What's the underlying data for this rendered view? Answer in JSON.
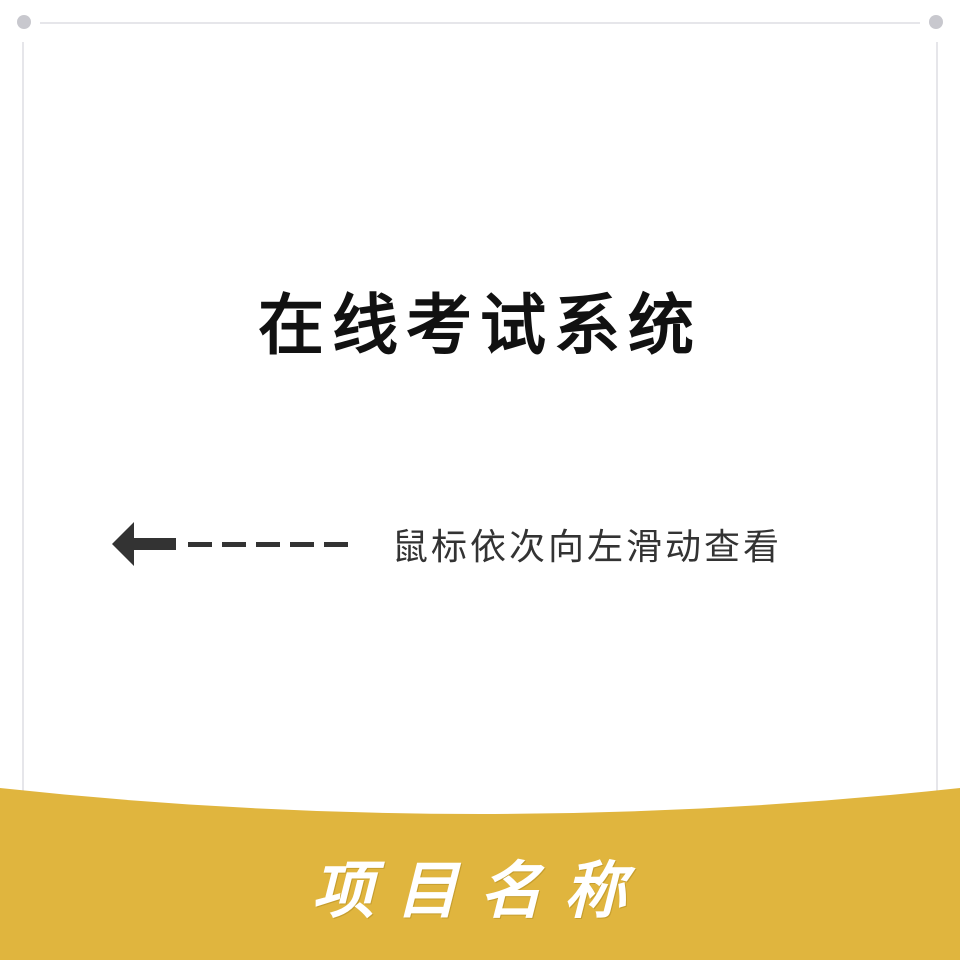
{
  "main": {
    "title": "在线考试系统",
    "hint": "鼠标依次向左滑动查看"
  },
  "icons": {
    "arrow": "arrow-left-icon"
  },
  "footer": {
    "label": "项目名称"
  },
  "colors": {
    "footer_bg": "#E0B53E",
    "frame": "#E6E6EA",
    "title": "#111111",
    "hint": "#333333"
  }
}
